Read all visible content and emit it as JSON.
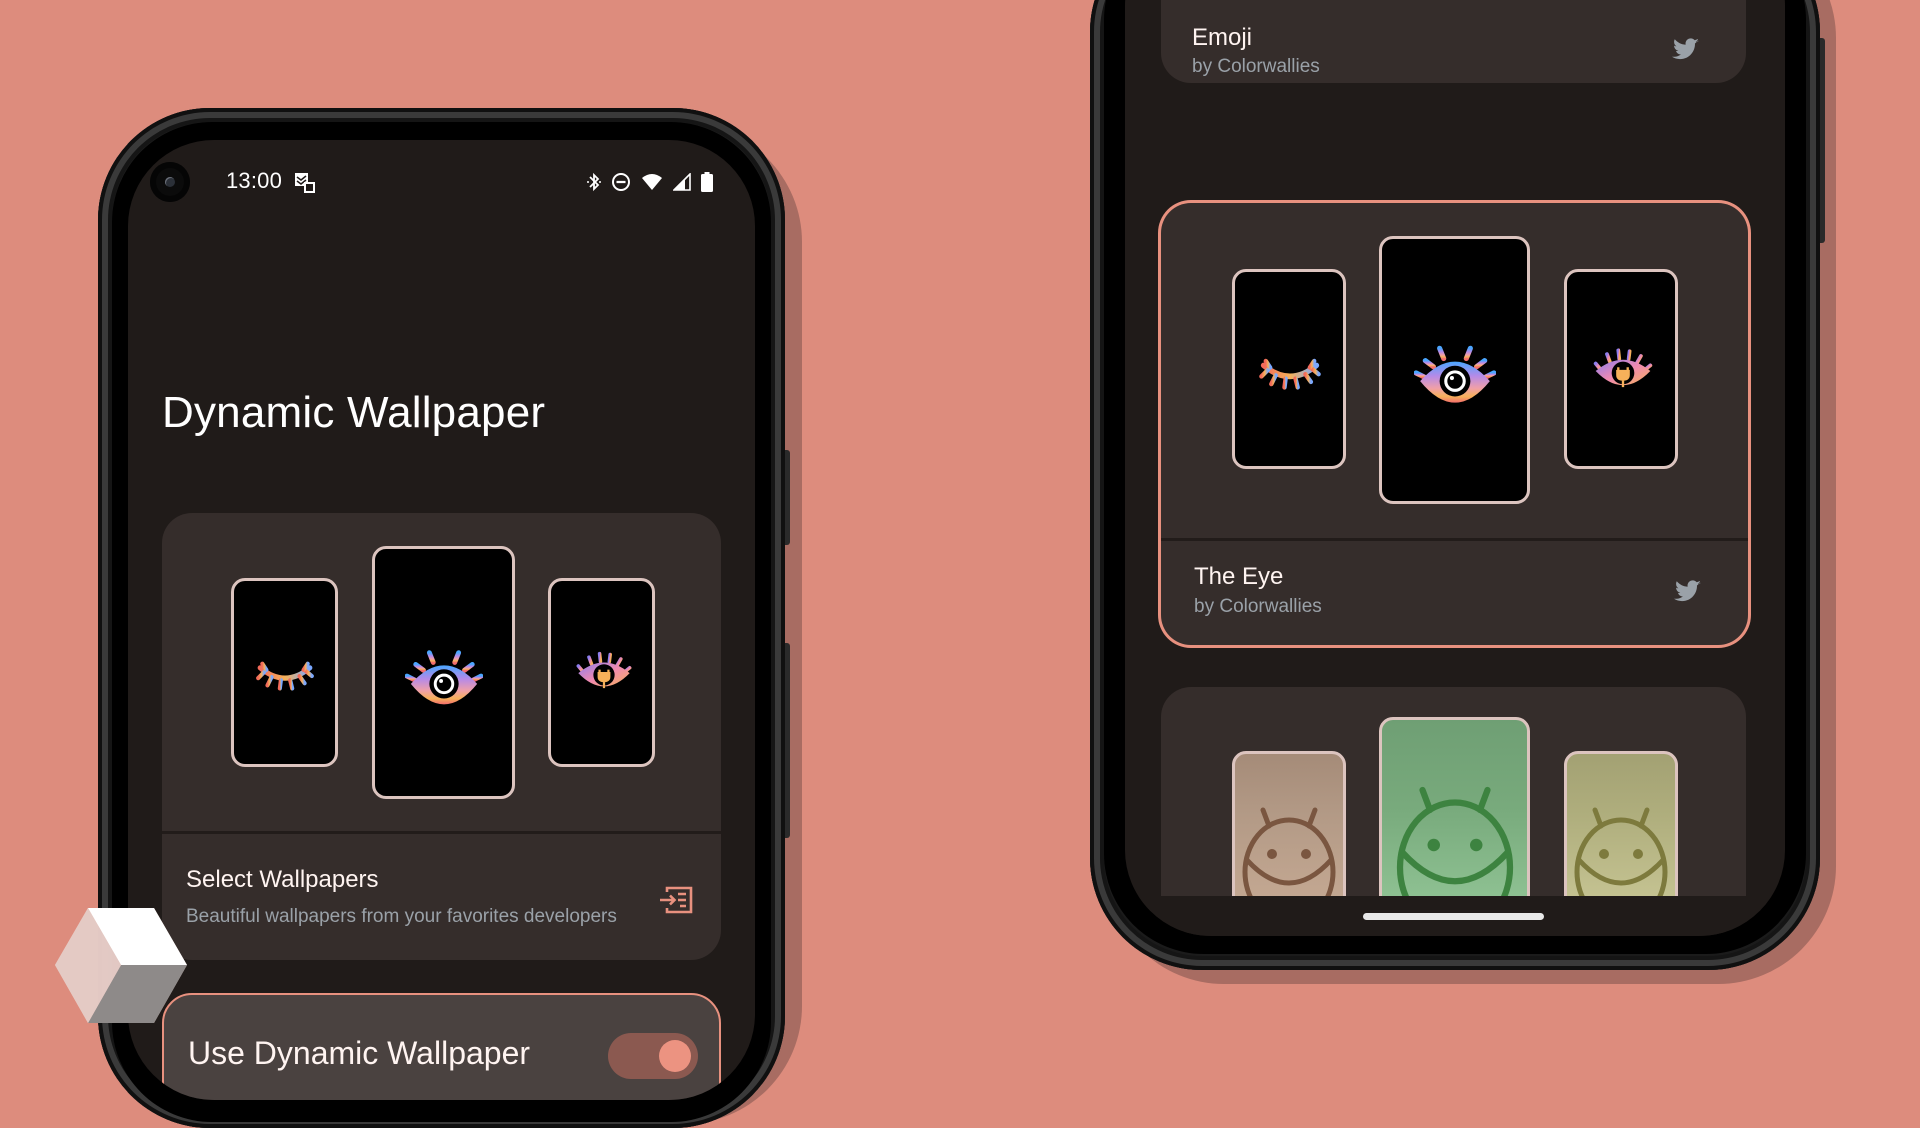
{
  "background_color": "#dd8c7d",
  "accent_color": "#e8917f",
  "left_phone": {
    "status_bar": {
      "time": "13:00",
      "notification_icon": "screenshot-notification-icon",
      "system_icons": [
        "bluetooth-icon",
        "do-not-disturb-icon",
        "wifi-icon",
        "cellular-signal-icon",
        "battery-icon"
      ]
    },
    "app_title": "Dynamic Wallpaper",
    "wallpaper_card": {
      "previews": [
        "closed-eye-wallpaper",
        "open-eye-wallpaper",
        "plug-eye-wallpaper"
      ],
      "title": "Select Wallpapers",
      "subtitle": "Beautiful wallpapers from your favorites developers",
      "action_icon": "select-wallpapers-icon"
    },
    "toggle_card": {
      "label": "Use Dynamic Wallpaper",
      "enabled": true
    }
  },
  "right_phone": {
    "wallpapers": [
      {
        "name": "Emoji",
        "author": "by Colorwallies",
        "link_icon": "twitter-icon",
        "selected": false
      },
      {
        "name": "The Eye",
        "author": "by Colorwallies",
        "link_icon": "twitter-icon",
        "selected": true,
        "previews": [
          "closed-eye-wallpaper",
          "open-eye-wallpaper",
          "plug-eye-wallpaper"
        ]
      },
      {
        "name": "",
        "author": "",
        "selected": false,
        "previews": [
          "android-brown-wallpaper",
          "android-green-wallpaper",
          "android-olive-wallpaper"
        ]
      }
    ]
  },
  "watermark": "cube-logo"
}
